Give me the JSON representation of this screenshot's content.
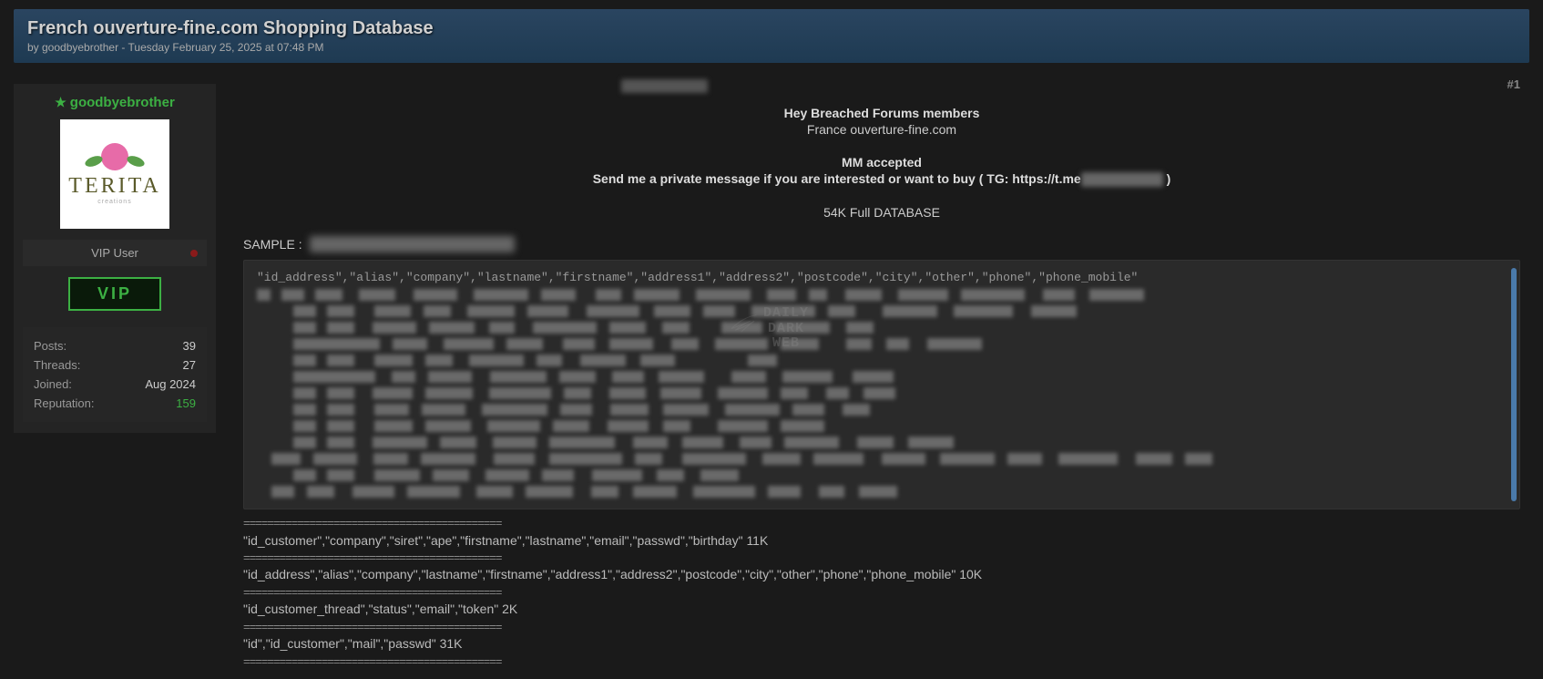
{
  "header": {
    "title": "French ouverture-fine.com Shopping Database",
    "byline": "by goodbyebrother - Tuesday February 25, 2025 at 07:48 PM"
  },
  "user": {
    "name": "goodbyebrother",
    "avatar_text": "TERITA",
    "avatar_sub": "creations",
    "status": "VIP User",
    "badge": "VIP",
    "stats": {
      "posts_label": "Posts:",
      "posts_value": "39",
      "threads_label": "Threads:",
      "threads_value": "27",
      "joined_label": "Joined:",
      "joined_value": "Aug 2024",
      "rep_label": "Reputation:",
      "rep_value": "159"
    }
  },
  "post": {
    "number": "#1",
    "line1": "Hey Breached Forums members",
    "line2": "France ouverture-fine.com",
    "line3": "MM accepted",
    "line4_prefix": "Send me a private message if you are interested or want to buy ( TG: ",
    "line4_link": "https://t.me",
    "line4_suffix": " )",
    "line5": "54K Full DATABASE",
    "sample_label": "SAMPLE :",
    "code_header": "\"id_address\",\"alias\",\"company\",\"lastname\",\"firstname\",\"address1\",\"address2\",\"postcode\",\"city\",\"other\",\"phone\",\"phone_mobile\"",
    "schema_divider": "===========================================",
    "schema1": "\"id_customer\",\"company\",\"siret\",\"ape\",\"firstname\",\"lastname\",\"email\",\"passwd\",\"birthday\" 11K",
    "schema2": "\"id_address\",\"alias\",\"company\",\"lastname\",\"firstname\",\"address1\",\"address2\",\"postcode\",\"city\",\"other\",\"phone\",\"phone_mobile\" 10K",
    "schema3": "\"id_customer_thread\",\"status\",\"email\",\"token\" 2K",
    "schema4": "\"id\",\"id_customer\",\"mail\",\"passwd\" 31K"
  },
  "watermark": {
    "l1": "DAILY",
    "l2": "DARK",
    "l3": "WEB"
  }
}
